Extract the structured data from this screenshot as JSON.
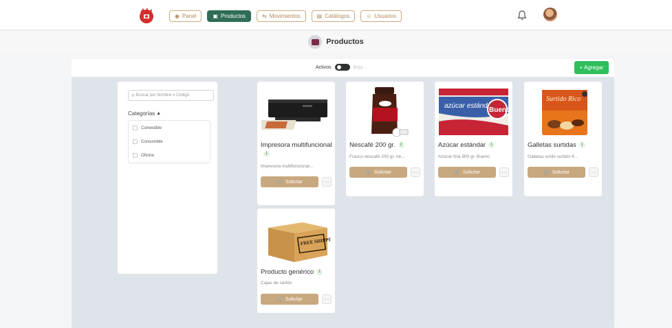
{
  "nav": {
    "items": [
      {
        "label": "Panel",
        "icon": "dashboard-icon",
        "active": false
      },
      {
        "label": "Productos",
        "icon": "box-icon",
        "active": true
      },
      {
        "label": "Movimientos",
        "icon": "movements-icon",
        "active": false
      },
      {
        "label": "Catálogos",
        "icon": "catalog-icon",
        "active": false
      },
      {
        "label": "Usuarios",
        "icon": "users-icon",
        "active": false
      }
    ]
  },
  "page": {
    "title": "Productos"
  },
  "toolbar": {
    "toggle_on_label": "Activos",
    "toggle_off_label": "Baja",
    "add_label": "+ Agregar"
  },
  "filter": {
    "search_placeholder": "Buscar por Nombre o Código",
    "categories_title": "Categorías",
    "categories": [
      "Comestible",
      "Consumible",
      "Oficina"
    ]
  },
  "products": [
    {
      "name": "Impresora multifuncional",
      "qty": "1",
      "desc": "Impresora multifuncional...",
      "button": "Solicitar",
      "image": "printer"
    },
    {
      "name": "Nescafé 200 gr.",
      "qty": "2",
      "desc": "Frasco nescafé 200 gr. ne...",
      "button": "Solicitar",
      "image": "coffee-jar"
    },
    {
      "name": "Azúcar estándar",
      "qty": "1",
      "desc": "Azúcar fina 900 gr. Bueno",
      "button": "Solicitar",
      "image": "sugar-bag"
    },
    {
      "name": "Galletas surtidas",
      "qty": "1",
      "desc": "Galletas estilo surtido 4...",
      "button": "Solicitar",
      "image": "cookie-box"
    },
    {
      "name": "Producto genérico",
      "qty": "1",
      "desc": "Cajas de cartón",
      "button": "Solicitar",
      "image": "cardboard-box"
    }
  ],
  "images": {
    "sugar_brand": "azúcar estándar",
    "sugar_label": "Bueno",
    "cookie_brand": "Surtido Rico",
    "box_stamp": "FREE SHIPPING"
  },
  "colors": {
    "accent": "#2f6e55",
    "button": "#c8a87e",
    "add": "#2fbf5c"
  }
}
